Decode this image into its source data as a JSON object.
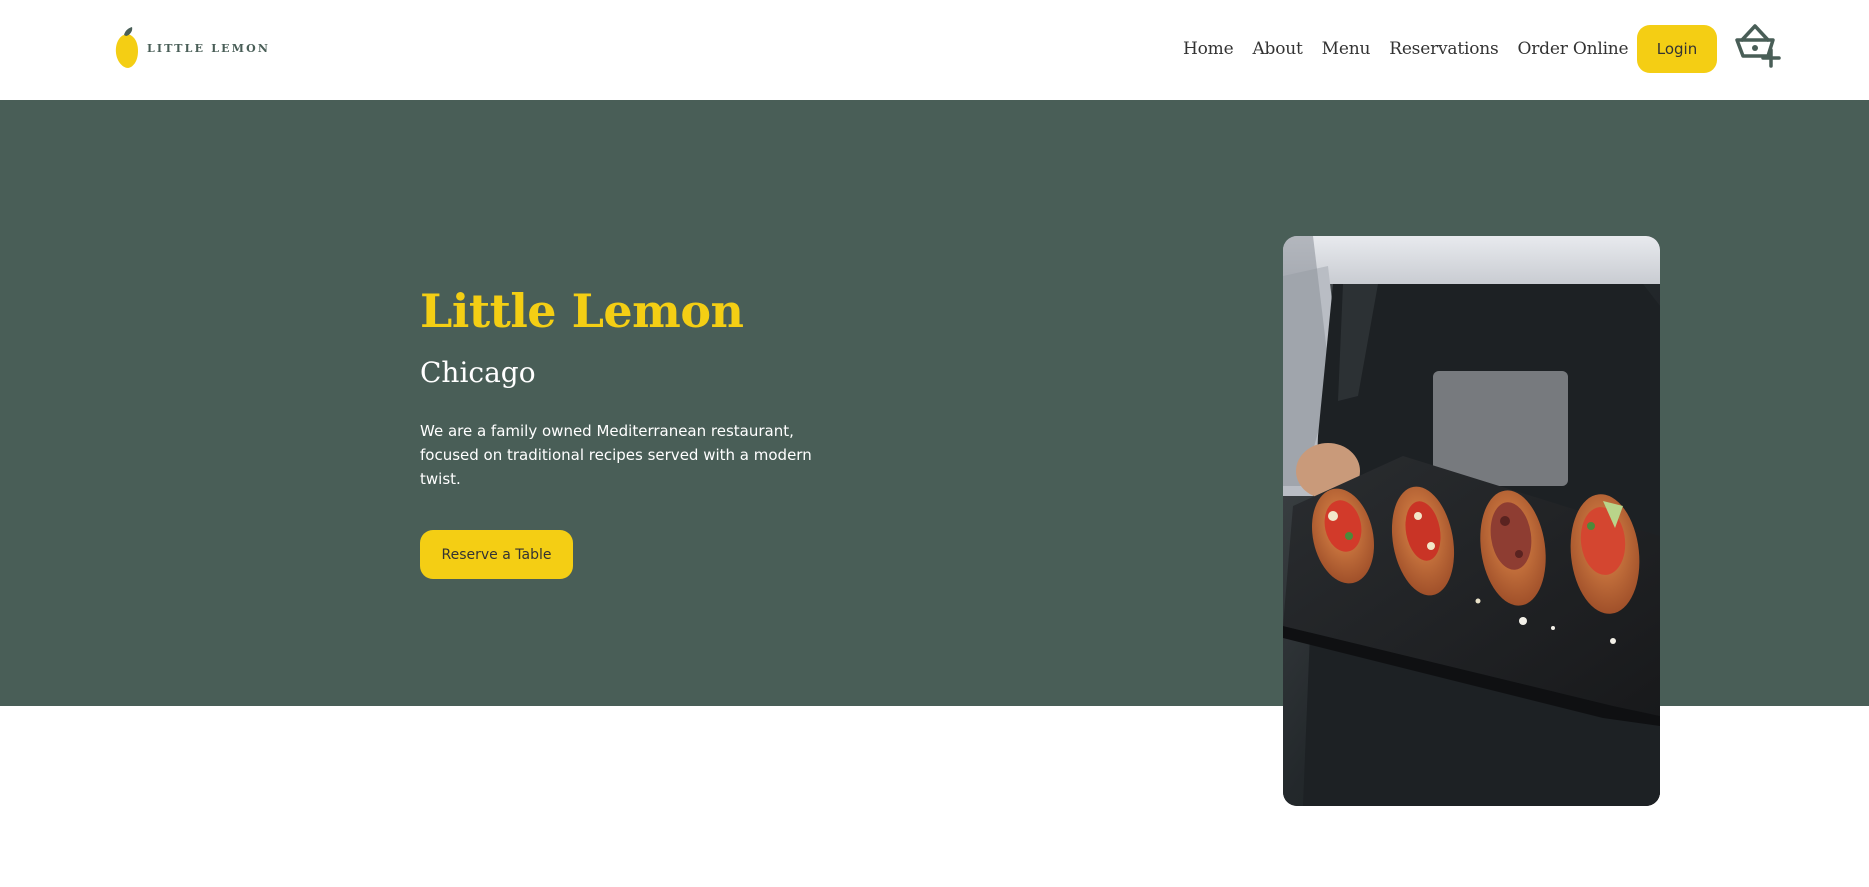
{
  "header": {
    "logo_text": "LITTLE LEMON",
    "nav": [
      {
        "label": "Home"
      },
      {
        "label": "About"
      },
      {
        "label": "Menu"
      },
      {
        "label": "Reservations"
      },
      {
        "label": "Order Online"
      }
    ],
    "login_label": "Login",
    "basket_icon": "basket-plus-icon"
  },
  "hero": {
    "title": "Little Lemon",
    "subtitle": "Chicago",
    "description": "We are a family owned Mediterranean restaurant, focused on traditional recipes served with a modern twist.",
    "cta_label": "Reserve a Table",
    "image_subject": "chef holding slate board with bruschetta"
  },
  "colors": {
    "primary_green": "#495e57",
    "primary_yellow": "#f4ce14",
    "text_dark": "#333333",
    "white": "#ffffff"
  }
}
